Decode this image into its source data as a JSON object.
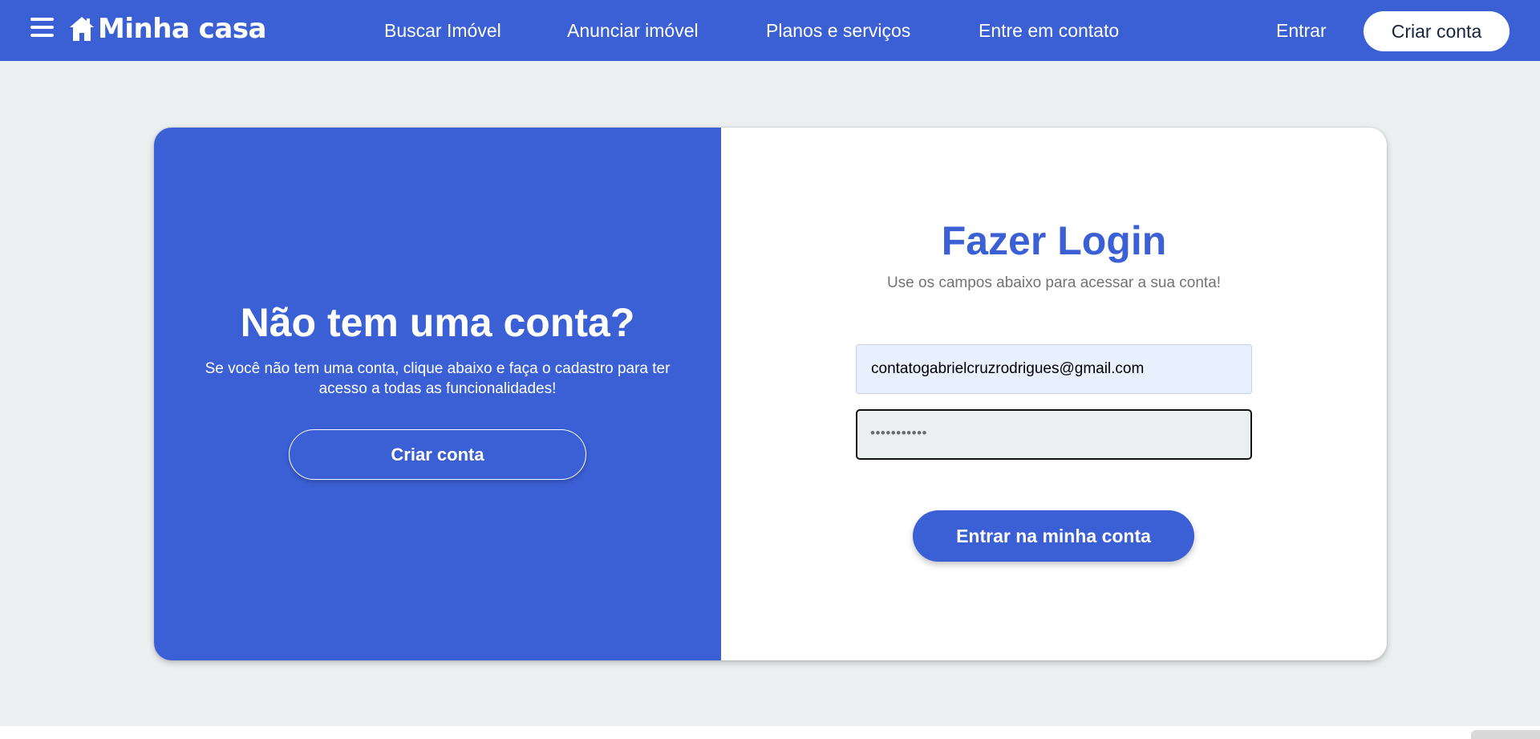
{
  "header": {
    "logo_text": "Minha casa",
    "nav": [
      {
        "label": "Buscar Imóvel"
      },
      {
        "label": "Anunciar imóvel"
      },
      {
        "label": "Planos e serviços"
      },
      {
        "label": "Entre em contato"
      }
    ],
    "login_label": "Entrar",
    "signup_label": "Criar conta"
  },
  "left_panel": {
    "title": "Não tem uma conta?",
    "description": "Se você não tem uma conta, clique abaixo e faça o cadastro para ter acesso a todas as funcionalidades!",
    "button_label": "Criar conta"
  },
  "login_form": {
    "title": "Fazer Login",
    "subtitle": "Use os campos abaixo para acessar a sua conta!",
    "email_value": "contatogabrielcruzrodrigues@gmail.com",
    "password_masked": "•••••••••••",
    "submit_label": "Entrar na minha conta"
  },
  "colors": {
    "brand": "#3b5fd4",
    "background": "#ebeff0",
    "email_fill": "#e8f0fe"
  },
  "icons": {
    "menu": "hamburger-menu-icon",
    "logo": "house-icon"
  }
}
